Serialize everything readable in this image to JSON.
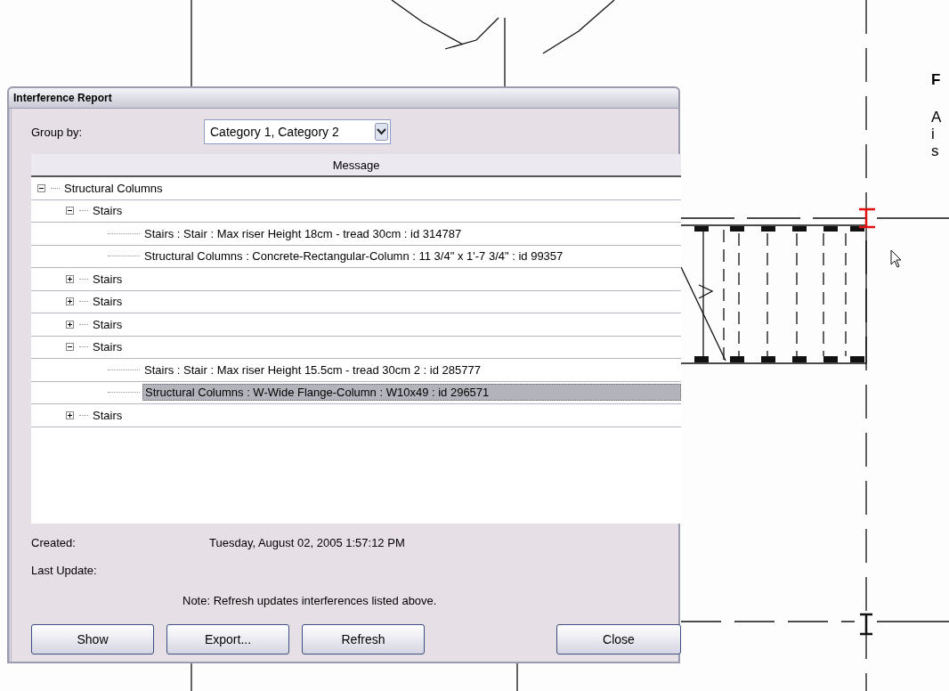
{
  "side_text": {
    "heading": "F",
    "lines": [
      "A",
      "i",
      "s"
    ]
  },
  "window": {
    "title": "Interference Report"
  },
  "group_by": {
    "label": "Group by:",
    "value": "Category 1, Category 2"
  },
  "table": {
    "columns": [
      "Message"
    ],
    "tree": [
      {
        "label": "Structural Columns",
        "expanded": true,
        "children": [
          {
            "label": "Stairs",
            "expanded": true,
            "children": [
              {
                "label": "Stairs : Stair : Max riser Height 18cm - tread 30cm : id 314787",
                "selected": false
              },
              {
                "label": "Structural Columns : Concrete-Rectangular-Column : 11 3/4\" x 1'-7 3/4\" : id 99357",
                "selected": false
              }
            ]
          },
          {
            "label": "Stairs",
            "expanded": false
          },
          {
            "label": "Stairs",
            "expanded": false
          },
          {
            "label": "Stairs",
            "expanded": false
          },
          {
            "label": "Stairs",
            "expanded": true,
            "children": [
              {
                "label": "Stairs : Stair : Max riser Height 15.5cm - tread 30cm 2 : id 285777",
                "selected": false
              },
              {
                "label": "Structural Columns : W-Wide Flange-Column : W10x49 : id 296571",
                "selected": true
              }
            ]
          },
          {
            "label": "Stairs",
            "expanded": false
          }
        ]
      }
    ]
  },
  "info": [
    {
      "label": "Created:",
      "value": "Tuesday, August 02, 2005 1:57:12 PM"
    },
    {
      "label": "Last Update:"
    }
  ],
  "note": "Note: Refresh updates interferences listed above.",
  "buttons": [
    "Show",
    "Export...",
    "Refresh",
    "Close"
  ]
}
